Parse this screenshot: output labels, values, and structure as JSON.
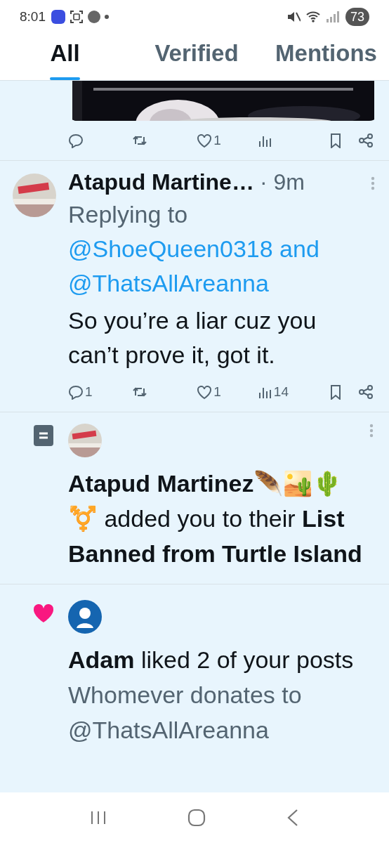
{
  "status_bar": {
    "time": "8:01",
    "battery": "73"
  },
  "tabs": [
    {
      "label": "All",
      "selected": true
    },
    {
      "label": "Verified",
      "selected": false
    },
    {
      "label": "Mentions",
      "selected": false
    }
  ],
  "items": [
    {
      "kind": "media_tail",
      "actions": [
        {
          "kind": "reply"
        },
        {
          "kind": "repost"
        },
        {
          "kind": "like",
          "count": "1"
        },
        {
          "kind": "views"
        },
        {
          "kind": "bookmark"
        },
        {
          "kind": "share"
        }
      ]
    },
    {
      "kind": "reply",
      "author": "Atapud Martine…",
      "time": "· 9m",
      "replying_prefix": "Replying to",
      "handles": [
        "@ShoeQueen0318",
        "@ThatsAllAreanna"
      ],
      "joiner": "and",
      "text": "So you’re a liar cuz you can’t prove it, got it.",
      "actions": [
        {
          "kind": "reply",
          "count": "1"
        },
        {
          "kind": "repost"
        },
        {
          "kind": "like",
          "count": "1"
        },
        {
          "kind": "views",
          "count": "14"
        },
        {
          "kind": "bookmark"
        },
        {
          "kind": "share"
        }
      ]
    },
    {
      "kind": "list_add",
      "text": "**Atapud Martinez🪶🏜️🌵 ⚧️** added you to their **List Banned from Turtle Island**"
    },
    {
      "kind": "like",
      "text": "**Adam** liked 2 of your posts",
      "preview": "Whomever donates to @ThatsAllAreanna"
    }
  ]
}
